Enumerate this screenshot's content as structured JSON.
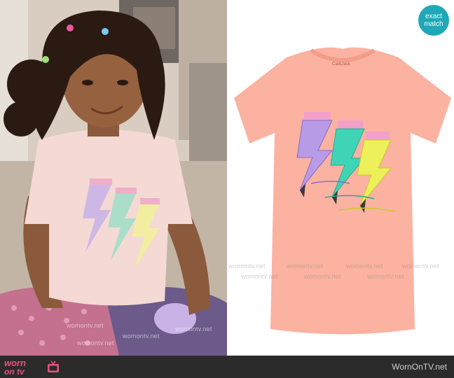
{
  "badge": {
    "line1": "exact",
    "line2": "match"
  },
  "product": {
    "tag_brand": "Cat&Jack"
  },
  "watermark": {
    "text": "womontv.net"
  },
  "footer": {
    "logo_top": "worn",
    "logo_bottom": "on tv",
    "site": "WornOnTV.net"
  },
  "colors": {
    "tee": "#fbb2a0",
    "tee_left": "#f7d6d2",
    "pencil_purple": "#b89be6",
    "pencil_teal": "#40d4b7",
    "pencil_yellow": "#eef05a",
    "badge": "#1fa8b8",
    "footer": "#2b2b2b",
    "logo": "#e9527c"
  }
}
